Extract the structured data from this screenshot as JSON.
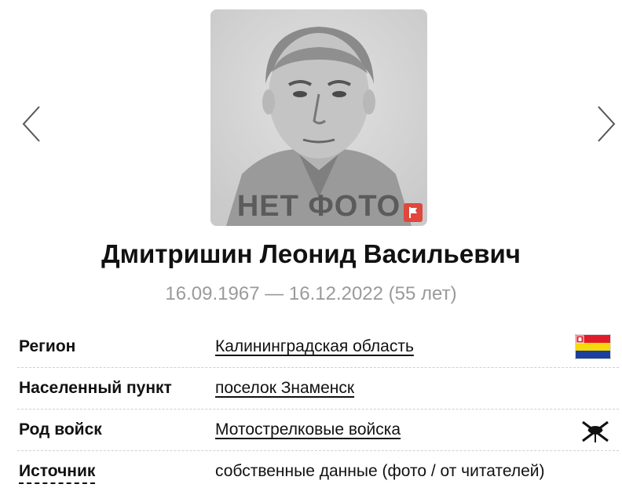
{
  "photo": {
    "placeholder_text": "НЕТ ФОТО",
    "report_icon": "flag-icon"
  },
  "navigation": {
    "prev_icon": "chevron-left-icon",
    "next_icon": "chevron-right-icon"
  },
  "person": {
    "name": "Дмитришин Леонид Васильевич",
    "dates": "16.09.1967 — 16.12.2022 (55 лет)"
  },
  "details": {
    "region": {
      "label": "Регион",
      "value": "Калининградская область",
      "icon": "region-flag-icon"
    },
    "settlement": {
      "label": "Населенный пункт",
      "value": "поселок Знаменск"
    },
    "branch": {
      "label": "Род войск",
      "value": "Мотострелковые войска",
      "icon": "motor-rifle-emblem-icon"
    },
    "source": {
      "label": "Источник",
      "value": "собственные данные (фото / от читателей)"
    }
  },
  "colors": {
    "accent_red": "#e0463c",
    "date_gray": "#9a9a9a"
  }
}
